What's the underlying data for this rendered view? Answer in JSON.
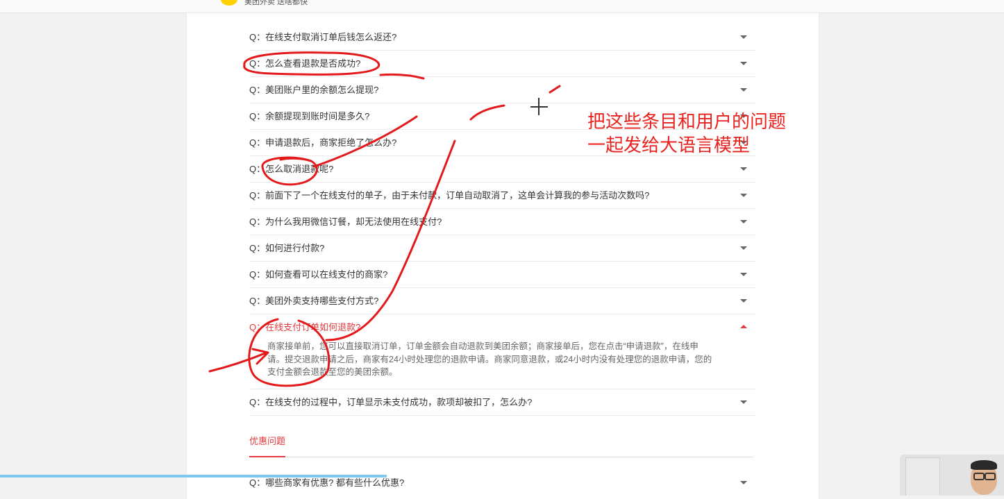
{
  "header": {
    "logo_text": "美团外卖 送啥都快"
  },
  "faq": {
    "items": [
      {
        "q": "Q：在线支付取消订单后钱怎么返还?"
      },
      {
        "q": "Q：怎么查看退款是否成功?"
      },
      {
        "q": "Q：美团账户里的余额怎么提现?"
      },
      {
        "q": "Q：余额提现到账时间是多久?"
      },
      {
        "q": "Q：申请退款后，商家拒绝了怎么办?"
      },
      {
        "q": "Q：怎么取消退款呢?"
      },
      {
        "q": "Q：前面下了一个在线支付的单子，由于未付款，订单自动取消了，这单会计算我的参与活动次数吗?"
      },
      {
        "q": "Q：为什么我用微信订餐，却无法使用在线支付?"
      },
      {
        "q": "Q：如何进行付款?"
      },
      {
        "q": "Q：如何查看可以在线支付的商家?"
      },
      {
        "q": "Q：美团外卖支持哪些支付方式?"
      }
    ],
    "open_item": {
      "q": "Q：在线支付订单如何退款?",
      "answer": "商家接单前，您可以直接取消订单，订单金额会自动退款到美团余额；商家接单后，您在点击“申请退款”，在线申请。提交退款申请之后，商家有24小时处理您的退款申请。商家同意退款，或24小时内没有处理您的退款申请，您的支付金额会退款至您的美团余额。"
    },
    "after_open": [
      {
        "q": "Q：在线支付的过程中，订单显示未支付成功，款项却被扣了，怎么办?"
      }
    ]
  },
  "section2": {
    "title": "优惠问题",
    "items": [
      {
        "q": "Q：哪些商家有优惠? 都有些什么优惠?"
      }
    ]
  },
  "annotation": {
    "line1": "把这些条目和用户的问题",
    "line2": "一起发给大语言模型",
    "ink_color": "#e3191b"
  },
  "colors": {
    "accent": "#e4393c",
    "progress": "#7ec8ee"
  }
}
